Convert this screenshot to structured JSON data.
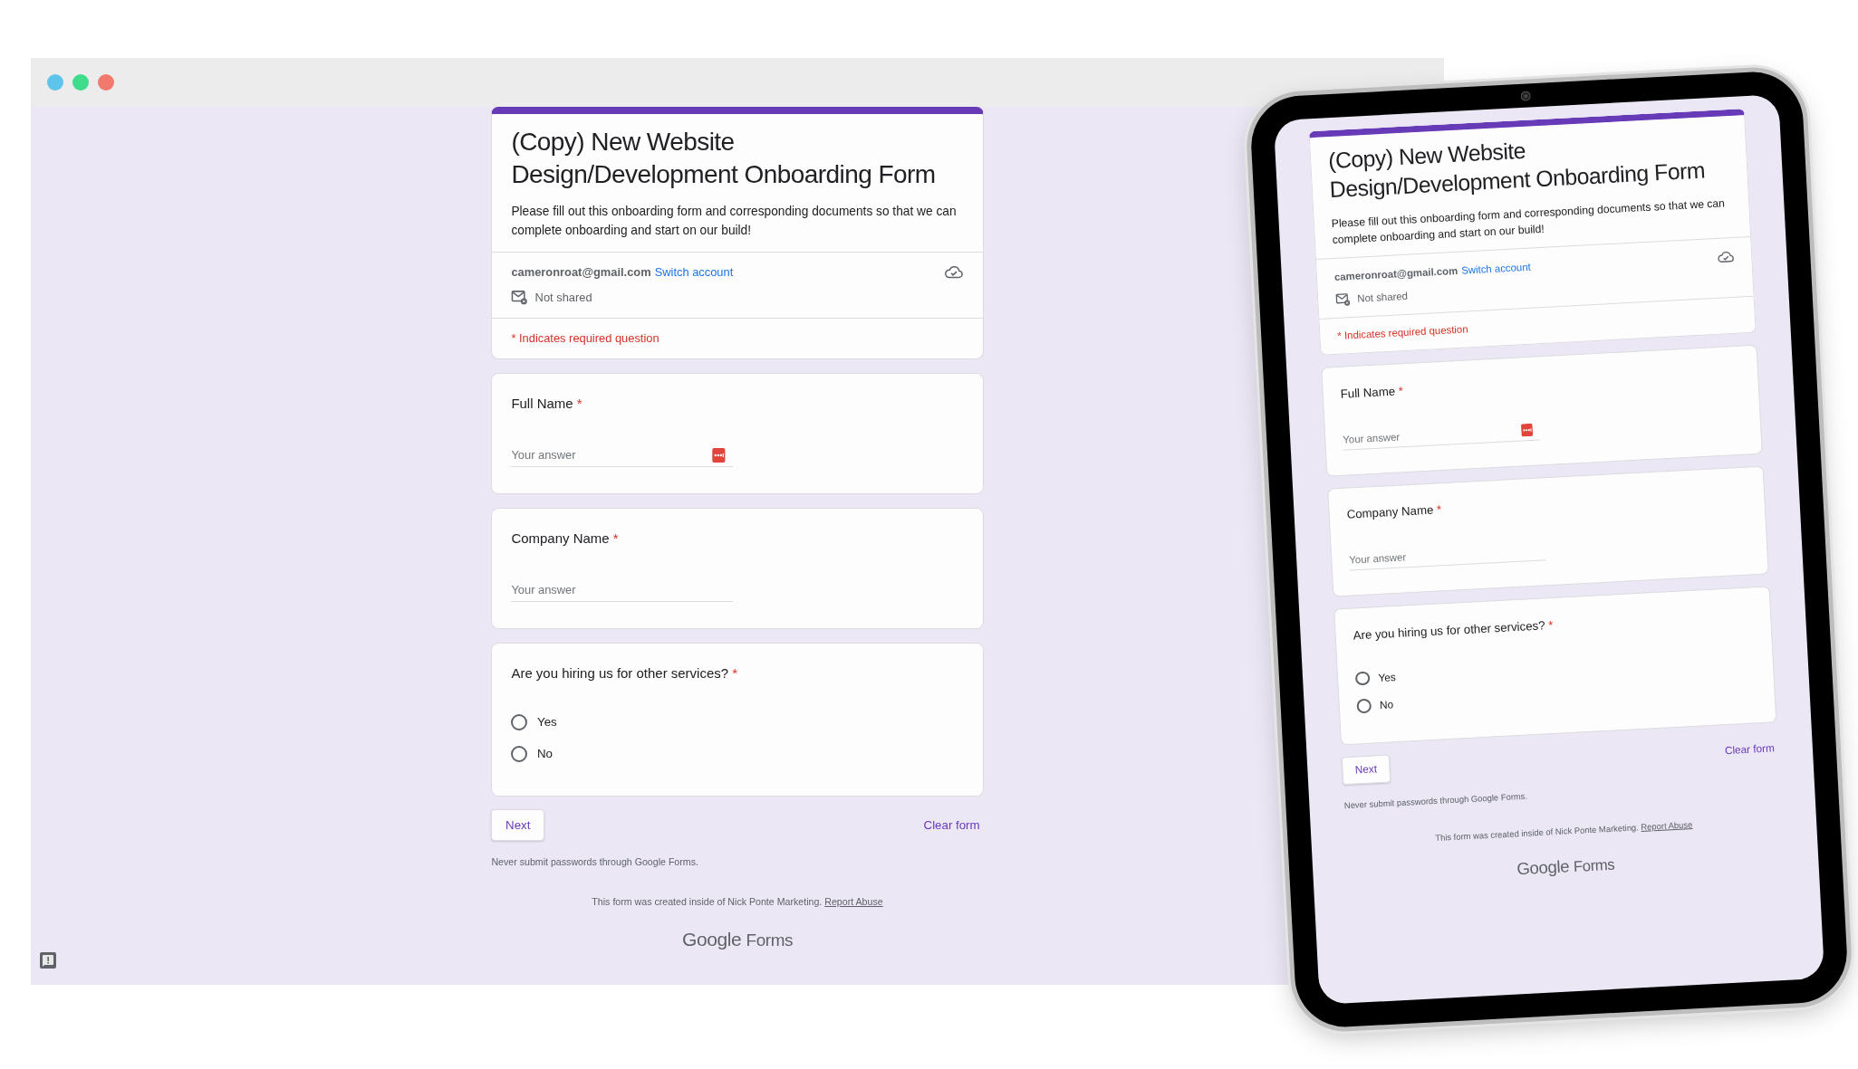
{
  "browser": {
    "window_controls": [
      {
        "color": "#5ec4ec"
      },
      {
        "color": "#3fdc8c"
      },
      {
        "color": "#f2796d"
      }
    ],
    "form": {
      "title": "(Copy) New Website Design/Development Onboarding Form",
      "description": "Please fill out this onboarding form and corresponding documents so that we can complete onboarding and start on our build!",
      "account_email": "cameronroat@gmail.com",
      "switch_account": "Switch account",
      "sharing": "Not shared",
      "required_note": "* Indicates required question",
      "questions": [
        {
          "kind": "text",
          "label": "Full Name",
          "required_mark": "*",
          "placeholder": "Your answer",
          "password_badge": true
        },
        {
          "kind": "text",
          "label": "Company Name",
          "required_mark": "*",
          "placeholder": "Your answer",
          "password_badge": false
        },
        {
          "kind": "radio",
          "label": "Are you hiring us for other services?",
          "required_mark": "*",
          "options": [
            {
              "label": "Yes",
              "selected": false
            },
            {
              "label": "No",
              "selected": false
            }
          ]
        }
      ],
      "next_button": "Next",
      "clear_button": "Clear form",
      "password_warning": "Never submit passwords through Google Forms.",
      "footer_note": "This form was created inside of Nick Ponte Marketing.",
      "report_link": "Report Abuse",
      "logo_google": "Google",
      "logo_forms": "Forms"
    }
  },
  "tablet": {
    "form": {
      "title": "(Copy) New Website Design/Development Onboarding Form",
      "description": "Please fill out this onboarding form and corresponding documents so that we can complete onboarding and start on our build!",
      "account_email": "cameronroat@gmail.com",
      "switch_account": "Switch account",
      "sharing": "Not shared",
      "required_note": "* Indicates required question",
      "questions": [
        {
          "kind": "text",
          "label": "Full Name",
          "required_mark": "*",
          "placeholder": "Your answer",
          "password_badge": true
        },
        {
          "kind": "text",
          "label": "Company Name",
          "required_mark": "*",
          "placeholder": "Your answer",
          "password_badge": false
        },
        {
          "kind": "radio",
          "label": "Are you hiring us for other services?",
          "required_mark": "*",
          "options": [
            {
              "label": "Yes",
              "selected": false
            },
            {
              "label": "No",
              "selected": false
            }
          ]
        }
      ],
      "next_button": "Next",
      "clear_button": "Clear form",
      "password_warning": "Never submit passwords through Google Forms.",
      "footer_note": "This form was created inside of Nick Ponte Marketing.",
      "report_link": "Report Abuse",
      "logo_google": "Google",
      "logo_forms": "Forms"
    }
  }
}
